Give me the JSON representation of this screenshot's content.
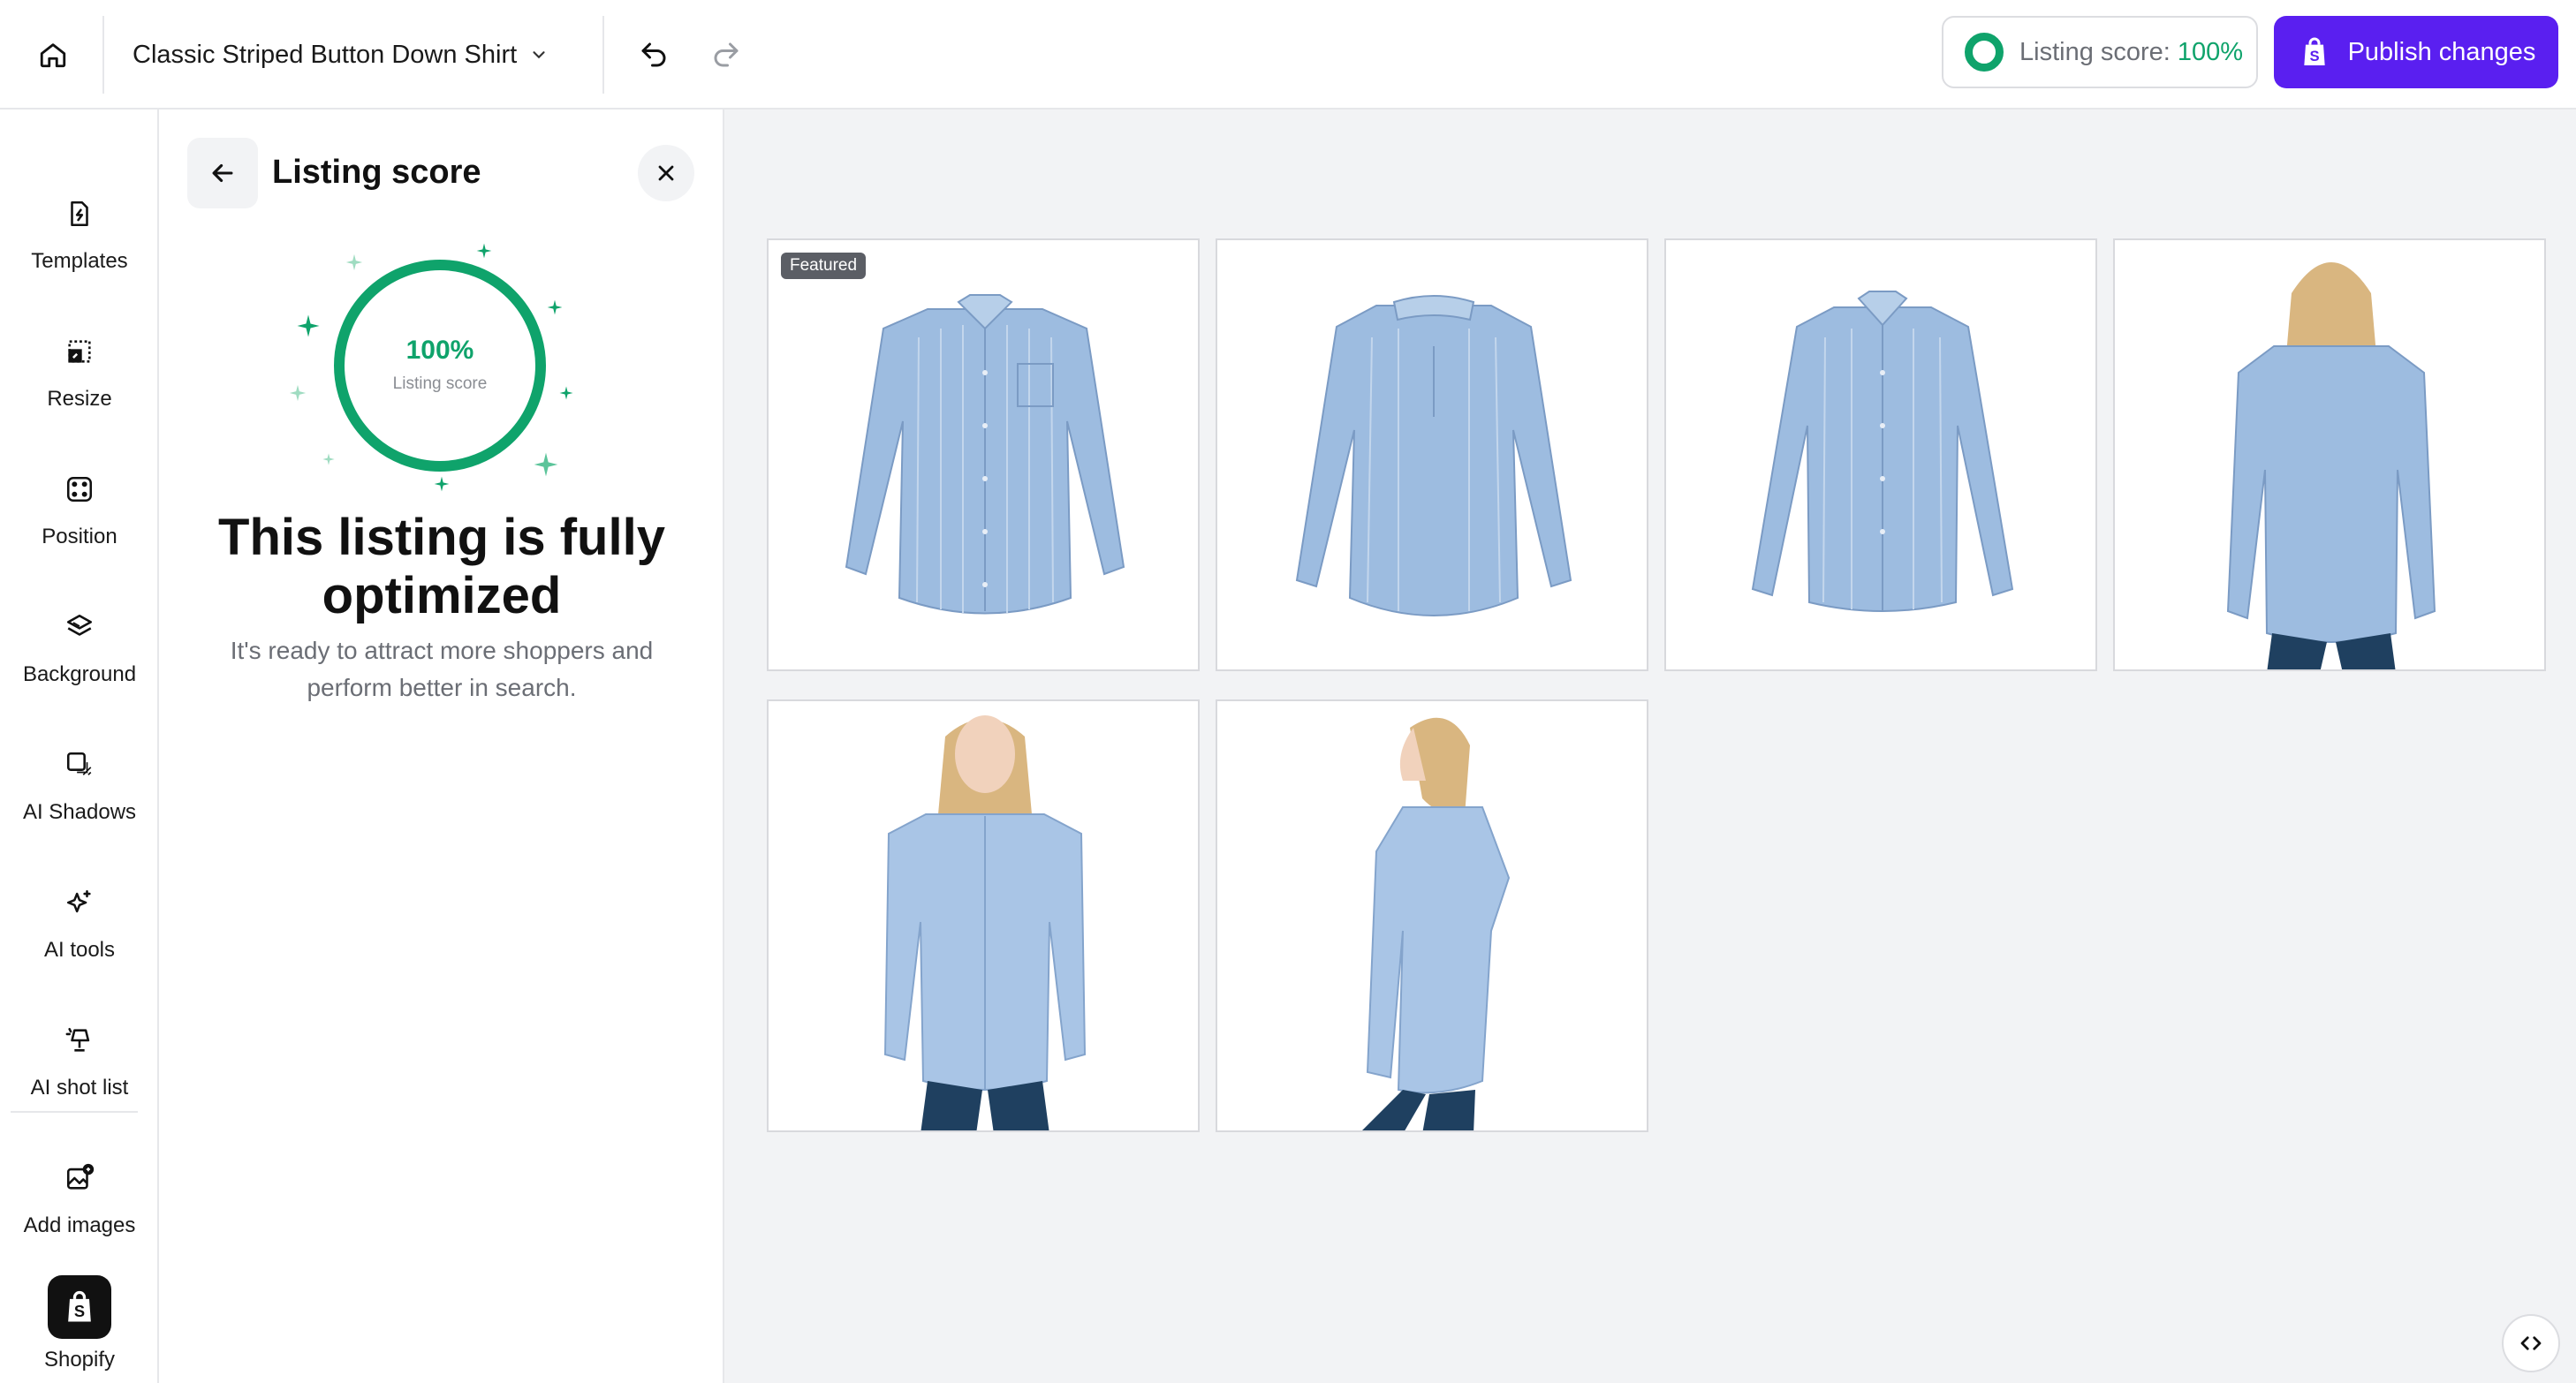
{
  "topbar": {
    "product_name": "Classic Striped Button Down Shirt",
    "listing_score_label": "Listing score:",
    "listing_score_value": "100%",
    "publish_label": "Publish changes"
  },
  "rail": {
    "items": [
      {
        "label": "Templates",
        "icon": "template-icon"
      },
      {
        "label": "Resize",
        "icon": "resize-icon"
      },
      {
        "label": "Position",
        "icon": "position-icon"
      },
      {
        "label": "Background",
        "icon": "layers-icon"
      },
      {
        "label": "AI Shadows",
        "icon": "shadow-icon"
      },
      {
        "label": "AI tools",
        "icon": "sparkle-icon"
      },
      {
        "label": "AI shot list",
        "icon": "lamp-icon"
      },
      {
        "label": "Add images",
        "icon": "add-image-icon"
      },
      {
        "label": "Shopify",
        "icon": "shopify-icon"
      }
    ]
  },
  "panel": {
    "title": "Listing score",
    "gauge_value": "100%",
    "gauge_label": "Listing score",
    "gauge_fraction": 1.0,
    "headline": "This listing is fully optimized",
    "subtext": "It's ready to attract more shoppers and perform better in search."
  },
  "gallery": {
    "featured_label": "Featured",
    "images": [
      {
        "kind": "shirt-front"
      },
      {
        "kind": "shirt-back"
      },
      {
        "kind": "shirt-3d"
      },
      {
        "kind": "model-back"
      },
      {
        "kind": "model-front"
      },
      {
        "kind": "model-side"
      }
    ]
  },
  "colors": {
    "accent": "#5a1ff0",
    "score_green": "#0fa36b",
    "shirt_blue": "#9dbce0",
    "jeans": "#1f4060",
    "hair": "#d9b680"
  }
}
